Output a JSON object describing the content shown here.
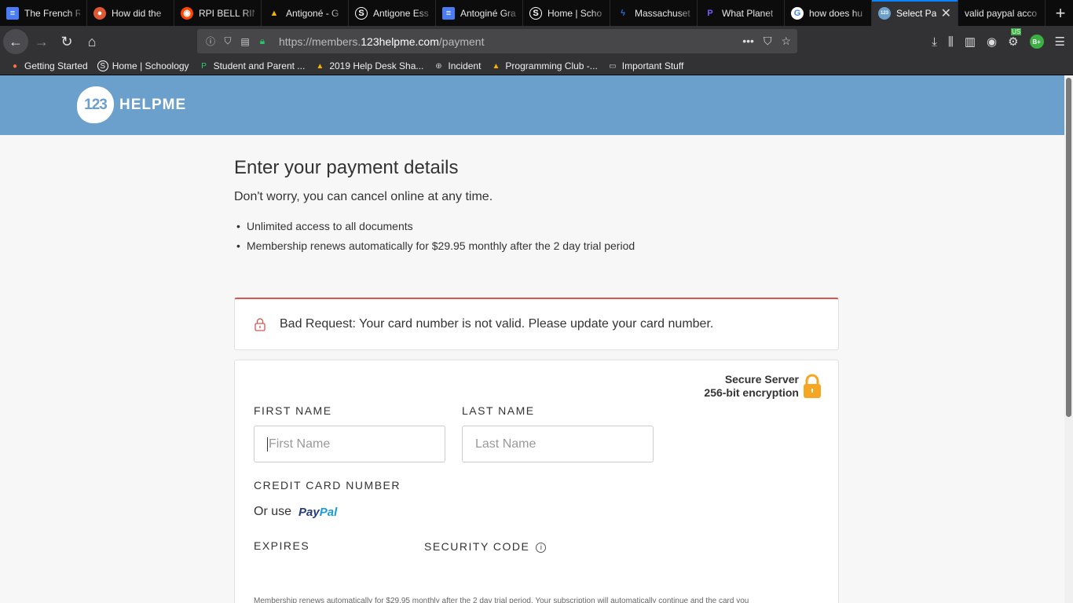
{
  "browser": {
    "tabs": [
      {
        "title": "The French R",
        "favicon": "docs-icon",
        "color": "#4a7cf7"
      },
      {
        "title": "How did the",
        "favicon": "duckduckgo-icon",
        "color": "#de5833"
      },
      {
        "title": "RPI BELL RIN",
        "favicon": "reddit-icon",
        "color": "#ff4500"
      },
      {
        "title": "Antigoné - G",
        "favicon": "drive-icon",
        "color": "#f4b400"
      },
      {
        "title": "Antigone Ess",
        "favicon": "schoology-icon",
        "color": "#ffffff"
      },
      {
        "title": "Antoginé Gra",
        "favicon": "docs-icon",
        "color": "#4a7cf7"
      },
      {
        "title": "Home | Scho",
        "favicon": "schoology-icon",
        "color": "#ffffff"
      },
      {
        "title": "Massachuset",
        "favicon": "bolt-icon",
        "color": "#2b6cd9"
      },
      {
        "title": "What Planet",
        "favicon": "p-icon",
        "color": "#7b5cff"
      },
      {
        "title": "how does hu",
        "favicon": "google-icon",
        "color": "#4285f4"
      },
      {
        "title": "Select Pa",
        "favicon": "123helpme-icon",
        "color": "#6b9fcc",
        "active": true
      },
      {
        "title": "valid paypal acco",
        "favicon": "",
        "color": ""
      }
    ],
    "url": {
      "prefix": "https://members.",
      "domain": "123helpme.com",
      "path": "/payment"
    },
    "extension_badge": "B+",
    "extension_country": "US"
  },
  "bookmarks": [
    {
      "label": "Getting Started",
      "icon": "firefox-icon"
    },
    {
      "label": "Home | Schoology",
      "icon": "schoology-icon"
    },
    {
      "label": "Student and Parent ...",
      "icon": "p-icon"
    },
    {
      "label": "2019 Help Desk Sha...",
      "icon": "drive-icon"
    },
    {
      "label": "Incident",
      "icon": "globe-icon"
    },
    {
      "label": "Programming Club -...",
      "icon": "drive-icon"
    },
    {
      "label": "Important Stuff",
      "icon": "folder-icon"
    }
  ],
  "site": {
    "logo_number": "123",
    "logo_text": "HELPME",
    "header_color": "#6b9fcc"
  },
  "payment": {
    "title": "Enter your payment details",
    "subtitle": "Don't worry, you can cancel online at any time.",
    "bullets": [
      "Unlimited access to all documents",
      "Membership renews automatically for $29.95 monthly after the 2 day trial period"
    ],
    "error_message": "Bad Request: Your card number is not valid. Please update your card number.",
    "secure_line1": "Secure Server",
    "secure_line2": "256-bit encryption",
    "first_name_label": "FIRST NAME",
    "first_name_placeholder": "First Name",
    "last_name_label": "LAST NAME",
    "last_name_placeholder": "Last Name",
    "card_label": "CREDIT CARD NUMBER",
    "or_use": "Or use",
    "paypal_part1": "Pay",
    "paypal_part2": "Pal",
    "expires_label": "EXPIRES",
    "security_code_label": "SECURITY CODE",
    "footnote": "Membership renews automatically for $29.95 monthly after the 2 day trial period. Your subscription will automatically continue and the card you"
  }
}
